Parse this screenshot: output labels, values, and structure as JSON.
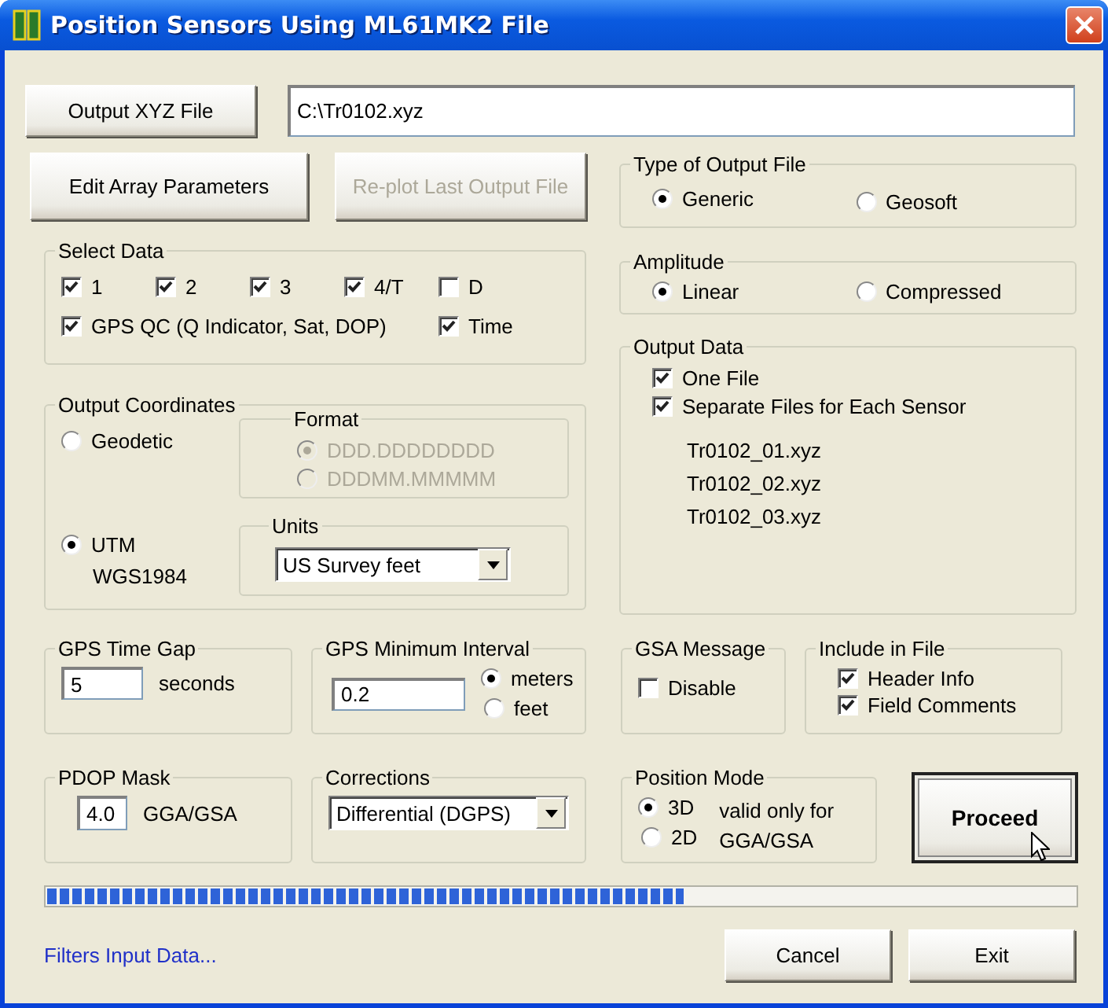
{
  "window": {
    "title": "Position Sensors Using ML61MK2 File"
  },
  "output_file": {
    "button": "Output XYZ File",
    "value": "C:\\Tr0102.xyz"
  },
  "action_buttons": [
    {
      "label": "Edit Array Parameters",
      "disabled": false
    },
    {
      "label": "Re-plot Last Output File",
      "disabled": true
    }
  ],
  "select_data": {
    "title": "Select Data",
    "items": [
      {
        "label": "1",
        "checked": true
      },
      {
        "label": "2",
        "checked": true
      },
      {
        "label": "3",
        "checked": true
      },
      {
        "label": "4/T",
        "checked": true
      },
      {
        "label": "D",
        "checked": false
      },
      {
        "label": "GPS QC (Q Indicator, Sat, DOP)",
        "checked": true
      },
      {
        "label": "Time",
        "checked": true
      }
    ]
  },
  "output_coordinates": {
    "title": "Output Coordinates",
    "systems": [
      {
        "label": "Geodetic",
        "selected": false
      },
      {
        "label": "UTM",
        "selected": true,
        "note": "WGS1984"
      }
    ],
    "format": {
      "title": "Format",
      "disabled": true,
      "options": [
        {
          "label": "DDD.DDDDDDDD",
          "selected": true
        },
        {
          "label": "DDDMM.MMMMM",
          "selected": false
        }
      ]
    },
    "units": {
      "title": "Units",
      "value": "US Survey feet"
    }
  },
  "type_of_output_file": {
    "title": "Type of Output File",
    "options": [
      {
        "label": "Generic",
        "selected": true
      },
      {
        "label": "Geosoft",
        "selected": false
      }
    ]
  },
  "amplitude": {
    "title": "Amplitude",
    "options": [
      {
        "label": "Linear",
        "selected": true
      },
      {
        "label": "Compressed",
        "selected": false
      }
    ]
  },
  "output_data": {
    "title": "Output Data",
    "options": [
      {
        "label": "One File",
        "checked": true
      },
      {
        "label": "Separate Files for Each Sensor",
        "checked": true
      }
    ],
    "files": [
      "Tr0102_01.xyz",
      "Tr0102_02.xyz",
      "Tr0102_03.xyz"
    ]
  },
  "gps_time_gap": {
    "title": "GPS Time Gap",
    "value": "5",
    "unit": "seconds"
  },
  "gps_minimum_interval": {
    "title": "GPS Minimum Interval",
    "value": "0.2",
    "options": [
      {
        "label": "meters",
        "selected": true
      },
      {
        "label": "feet",
        "selected": false
      }
    ]
  },
  "gsa_message": {
    "title": "GSA Message",
    "options": [
      {
        "label": "Disable",
        "checked": false
      }
    ]
  },
  "include_in_file": {
    "title": "Include in File",
    "options": [
      {
        "label": "Header Info",
        "checked": true
      },
      {
        "label": "Field Comments",
        "checked": true
      }
    ]
  },
  "pdop_mask": {
    "title": "PDOP Mask",
    "value": "4.0",
    "unit": "GGA/GSA"
  },
  "corrections": {
    "title": "Corrections",
    "value": "Differential (DGPS)"
  },
  "position_mode": {
    "title": "Position Mode",
    "options": [
      {
        "label": "3D",
        "selected": true
      },
      {
        "label": "2D",
        "selected": false
      }
    ],
    "note": "valid only for GGA/GSA"
  },
  "proceed_button": {
    "label": "Proceed",
    "focused": true
  },
  "progress": {
    "level": 0.62
  },
  "filters_link": "Filters Input Data...",
  "dialog_buttons": [
    {
      "label": "Cancel"
    },
    {
      "label": "Exit"
    }
  ]
}
